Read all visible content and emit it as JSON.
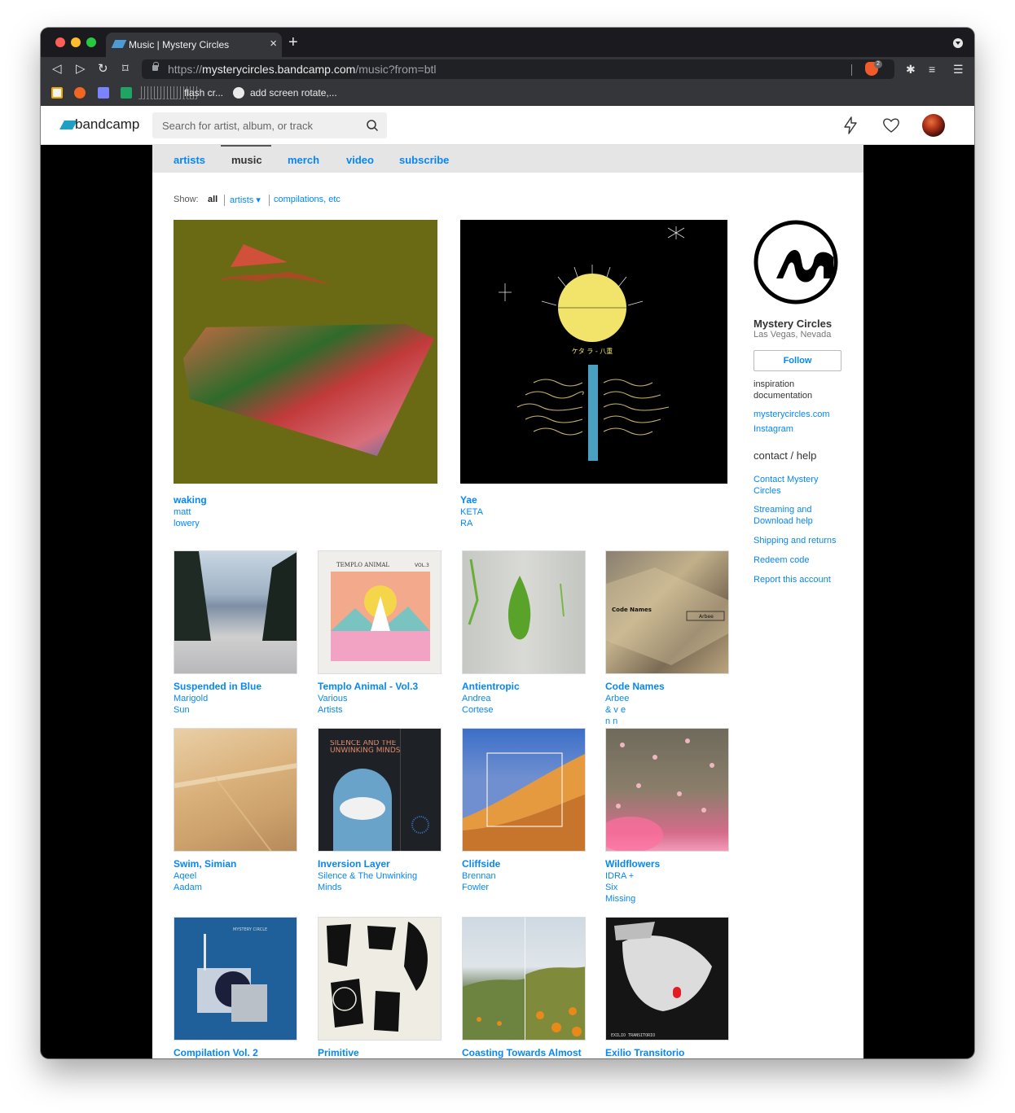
{
  "browser": {
    "tab_title": "Music | Mystery Circles",
    "url_scheme": "https://",
    "url_host": "mysterycircles.bandcamp.com",
    "url_path": "/music?from=btl",
    "brave_badge": "2",
    "bookmarks": {
      "item_flash": "flash cr...",
      "item_github": "add screen rotate,..."
    }
  },
  "header": {
    "logo": "bandcamp",
    "search_placeholder": "Search for artist, album, or track"
  },
  "subnav": [
    "artists",
    "music",
    "merch",
    "video",
    "subscribe"
  ],
  "filter": {
    "show_label": "Show:",
    "all": "all",
    "artists": "artists ▾",
    "compilations": "compilations, etc"
  },
  "featured": [
    {
      "title": "waking",
      "artist": "matt lowery"
    },
    {
      "title": "Yae",
      "artist": "KETA RA"
    }
  ],
  "albums": [
    {
      "title": "Suspended in Blue",
      "artist": "Marigold Sun"
    },
    {
      "title": "Templo Animal - Vol.3",
      "artist": "Various Artists"
    },
    {
      "title": "Antientropic",
      "artist": "Andrea Cortese"
    },
    {
      "title": "Code Names",
      "artist": "Arbee & v e n n"
    },
    {
      "title": "Swim, Simian",
      "artist": "Aqeel Aadam"
    },
    {
      "title": "Inversion Layer",
      "artist": "Silence & The Unwinking Minds"
    },
    {
      "title": "Cliffside",
      "artist": "Brennan Fowler"
    },
    {
      "title": "Wildflowers",
      "artist": "IDRA + Six Missing"
    },
    {
      "title": "Compilation Vol. 2",
      "artist": ""
    },
    {
      "title": "Primitive",
      "artist": ""
    },
    {
      "title": "Coasting Towards Almost",
      "artist": ""
    },
    {
      "title": "Exilio Transitorio",
      "artist": ""
    }
  ],
  "art_text": {
    "yae_caption": "ケタ ラ - 八重",
    "templo_header": "TEMPLO ANIMAL",
    "templo_vol": "VOL.3",
    "code_names": "Code Names",
    "arbee": "Arbee",
    "inversion_text": "SILENCE AND THE UNWINKING MINDS",
    "compilation_text": "MYSTERY CIRCLE",
    "exilio_text": "EXILIO TRANSITORIO"
  },
  "sidebar": {
    "band_name": "Mystery Circles",
    "location": "Las Vegas, Nevada",
    "follow": "Follow",
    "bio": "inspiration documentation",
    "links": [
      "mysterycircles.com",
      "Instagram"
    ],
    "contact_heading": "contact / help",
    "help_links": [
      "Contact Mystery Circles",
      "Streaming and Download help",
      "Shipping and returns",
      "Redeem code",
      "Report this account"
    ]
  },
  "colors": {
    "link": "#0687f5",
    "nav_bg": "#e5e5e5",
    "brand": "#1da0c3"
  }
}
